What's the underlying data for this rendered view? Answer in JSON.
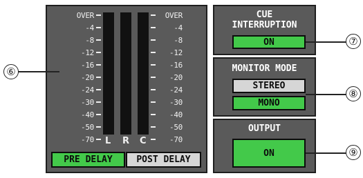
{
  "meter": {
    "scale_labels": [
      "OVER",
      "-4",
      "-8",
      "-12",
      "-16",
      "-20",
      "-24",
      "-30",
      "-40",
      "-50",
      "-70"
    ],
    "channels": [
      "L",
      "R",
      "C"
    ],
    "pre_delay_label": "PRE DELAY",
    "post_delay_label": "POST DELAY"
  },
  "cue_interruption": {
    "title_line1": "CUE",
    "title_line2": "INTERRUPTION",
    "button_label": "ON"
  },
  "monitor_mode": {
    "title": "MONITOR MODE",
    "stereo_label": "STEREO",
    "mono_label": "MONO"
  },
  "output": {
    "title": "OUTPUT",
    "button_label": "ON"
  },
  "callouts": {
    "c6": "⑥",
    "c7": "⑦",
    "c8": "⑧",
    "c9": "⑨"
  },
  "colors": {
    "panel": "#5a5a5a",
    "active_green": "#43c94a",
    "inactive_gray": "#d6d6d6",
    "meter_bar": "#111111"
  }
}
